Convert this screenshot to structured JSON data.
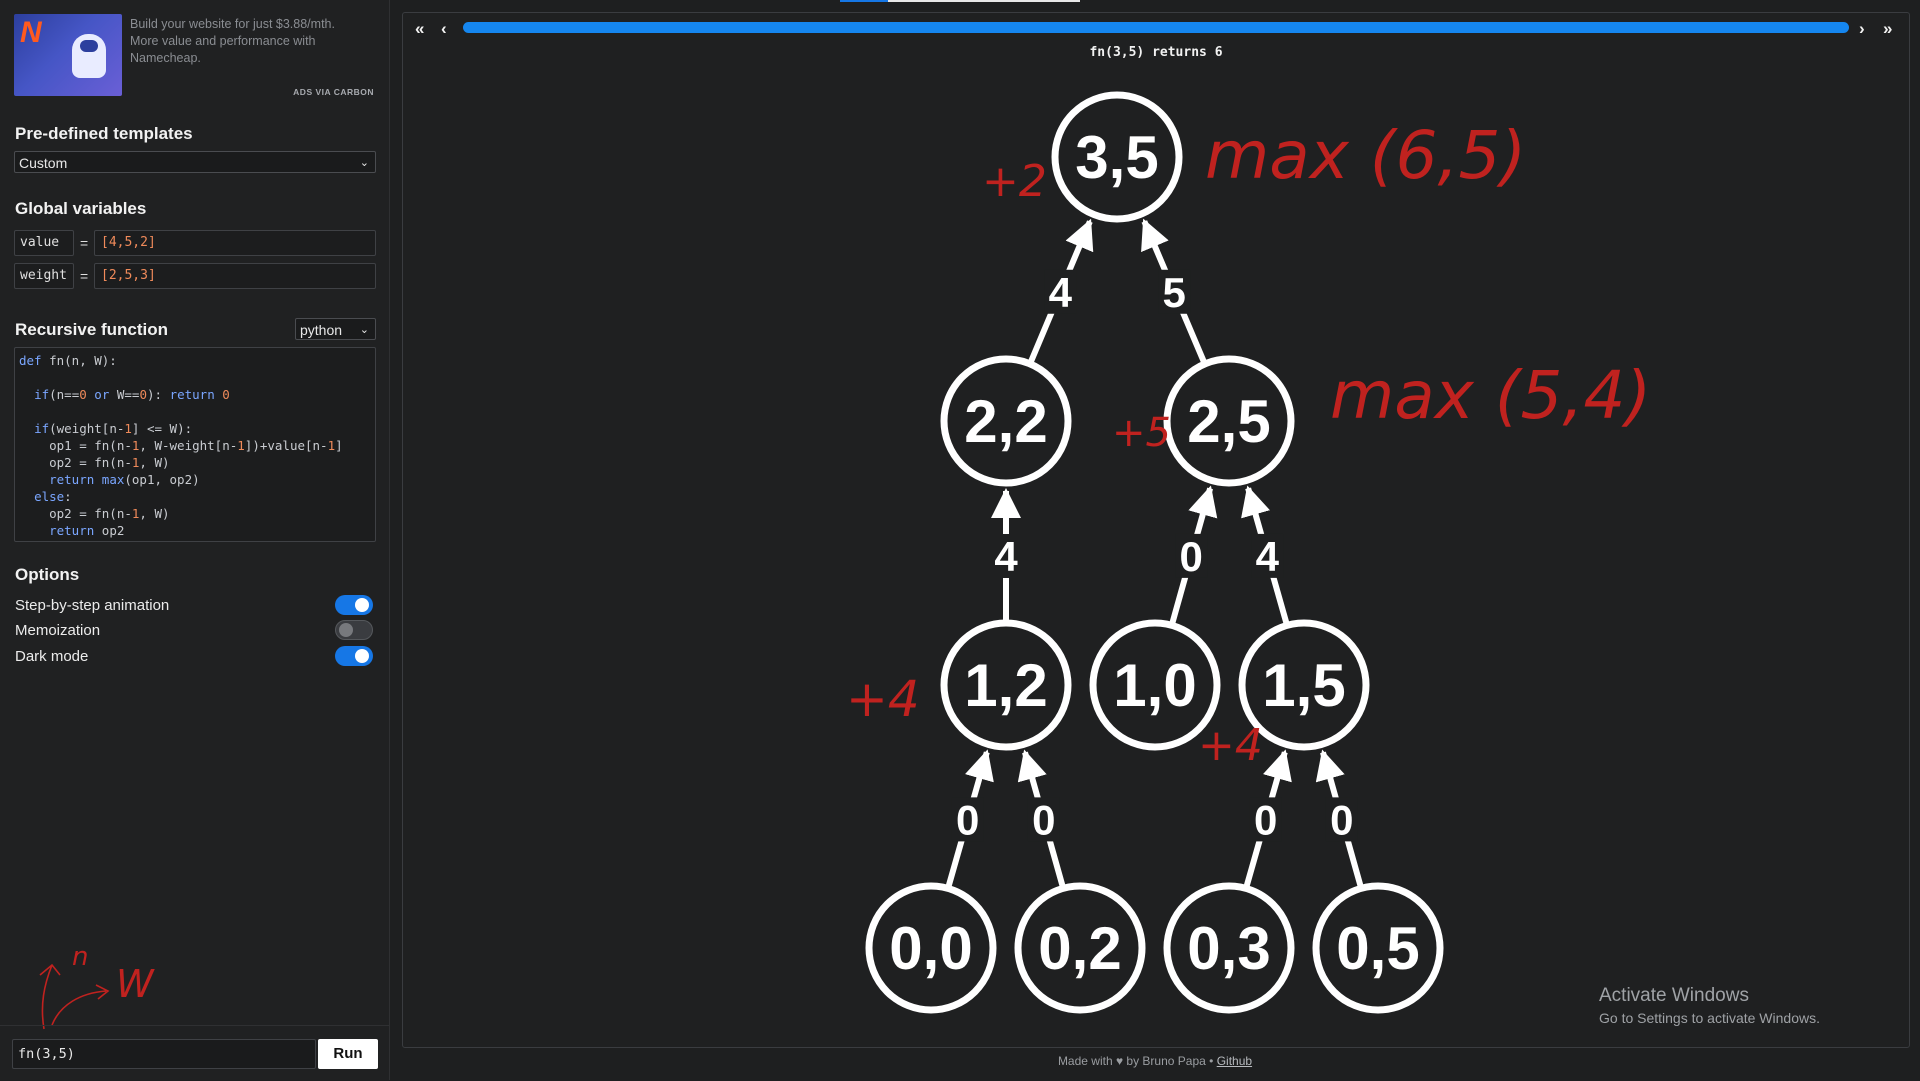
{
  "ad": {
    "text": "Build your website for just $3.88/mth. More value and performance with Namecheap.",
    "via": "ADS VIA CARBON"
  },
  "templates": {
    "title": "Pre-defined templates",
    "selected": "Custom"
  },
  "globals": {
    "title": "Global variables",
    "items": [
      {
        "name": "value",
        "value": "[4,5,2]"
      },
      {
        "name": "weight",
        "value": "[2,5,3]"
      }
    ],
    "eq": "="
  },
  "function": {
    "title": "Recursive function",
    "language": "python",
    "code_lines": [
      "def fn(n, W):",
      "",
      "  if(n==0 or W==0): return 0",
      "",
      "  if(weight[n-1] <= W):",
      "    op1 = fn(n-1, W-weight[n-1])+value[n-1]",
      "    op2 = fn(n-1, W)",
      "    return max(op1, op2)",
      "  else:",
      "    op2 = fn(n-1, W)",
      "    return op2"
    ]
  },
  "options": {
    "title": "Options",
    "items": [
      {
        "label": "Step-by-step animation",
        "on": true
      },
      {
        "label": "Memoization",
        "on": false
      },
      {
        "label": "Dark mode",
        "on": true
      }
    ]
  },
  "run": {
    "input_value": "fn(3,5)",
    "button_label": "Run"
  },
  "viewer": {
    "nav": {
      "first": "«",
      "prev": "‹",
      "next": "›",
      "last": "»"
    },
    "progress": 1.0,
    "status": "fn(3,5) returns 6"
  },
  "tree": {
    "nodes": [
      {
        "id": "n35",
        "label": "3,5"
      },
      {
        "id": "n22",
        "label": "2,2"
      },
      {
        "id": "n25",
        "label": "2,5"
      },
      {
        "id": "n12",
        "label": "1,2"
      },
      {
        "id": "n10",
        "label": "1,0"
      },
      {
        "id": "n15",
        "label": "1,5"
      },
      {
        "id": "n00",
        "label": "0,0"
      },
      {
        "id": "n02",
        "label": "0,2"
      },
      {
        "id": "n03",
        "label": "0,3"
      },
      {
        "id": "n05",
        "label": "0,5"
      }
    ],
    "edges": [
      {
        "from": "n22",
        "to": "n35",
        "label": "4"
      },
      {
        "from": "n25",
        "to": "n35",
        "label": "5"
      },
      {
        "from": "n12",
        "to": "n22",
        "label": "4"
      },
      {
        "from": "n10",
        "to": "n25",
        "label": "0"
      },
      {
        "from": "n15",
        "to": "n25",
        "label": "4"
      },
      {
        "from": "n00",
        "to": "n12",
        "label": "0"
      },
      {
        "from": "n02",
        "to": "n12",
        "label": "0"
      },
      {
        "from": "n03",
        "to": "n15",
        "label": "0"
      },
      {
        "from": "n05",
        "to": "n15",
        "label": "0"
      }
    ]
  },
  "annotations": [
    {
      "text": "max (6,5)"
    },
    {
      "text": "max (5,4)"
    },
    {
      "text": "+2"
    },
    {
      "text": "+5"
    },
    {
      "text": "+4"
    },
    {
      "text": "+4"
    },
    {
      "text": "n"
    },
    {
      "text": "W"
    }
  ],
  "annotation_color": "#c0221f",
  "windows_watermark": {
    "line1": "Activate Windows",
    "line2": "Go to Settings to activate Windows."
  },
  "footer": {
    "made_with": "Made with ♥ by Bruno Papa •",
    "link": "Github"
  }
}
